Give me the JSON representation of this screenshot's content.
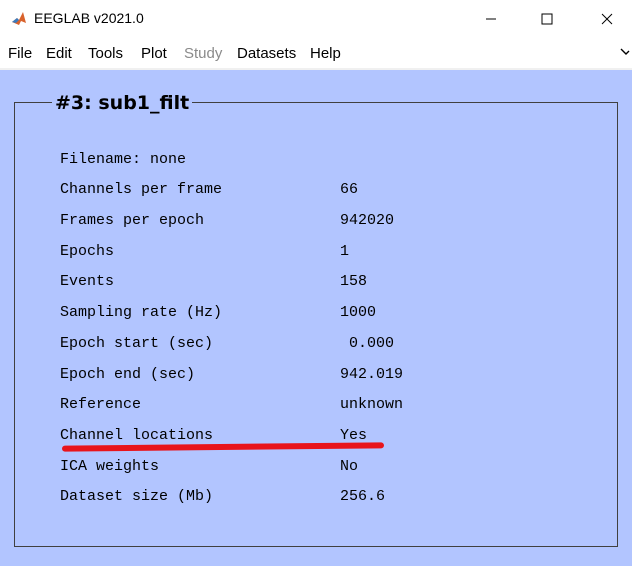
{
  "window": {
    "title": "EEGLAB v2021.0",
    "icons": [
      "matlab-logo-icon",
      "minimize-icon",
      "maximize-icon",
      "close-icon"
    ]
  },
  "menu": {
    "items": [
      {
        "label": "File",
        "enabled": true
      },
      {
        "label": "Edit",
        "enabled": true
      },
      {
        "label": "Tools",
        "enabled": true
      },
      {
        "label": "Plot",
        "enabled": true
      },
      {
        "label": "Study",
        "enabled": false
      },
      {
        "label": "Datasets",
        "enabled": true
      },
      {
        "label": "Help",
        "enabled": true
      }
    ],
    "overflow_icon": "menu-overflow-icon"
  },
  "dataset": {
    "title": "#3: sub1_filt",
    "filename": "Filename: none",
    "rows": [
      {
        "label": "Channels per frame",
        "value": "66"
      },
      {
        "label": "Frames per epoch",
        "value": "942020"
      },
      {
        "label": "Epochs",
        "value": "1"
      },
      {
        "label": "Events",
        "value": "158"
      },
      {
        "label": "Sampling rate (Hz)",
        "value": "1000"
      },
      {
        "label": "Epoch start (sec)",
        "value": " 0.000"
      },
      {
        "label": "Epoch end (sec)",
        "value": "942.019"
      },
      {
        "label": "Reference",
        "value": "unknown"
      },
      {
        "label": "Channel locations",
        "value": "Yes"
      },
      {
        "label": "ICA weights",
        "value": "No"
      },
      {
        "label": "Dataset size (Mb)",
        "value": "256.6"
      }
    ]
  },
  "colors": {
    "panel_bg": "#b2c5ff",
    "highlight_mark": "#e8141b"
  }
}
